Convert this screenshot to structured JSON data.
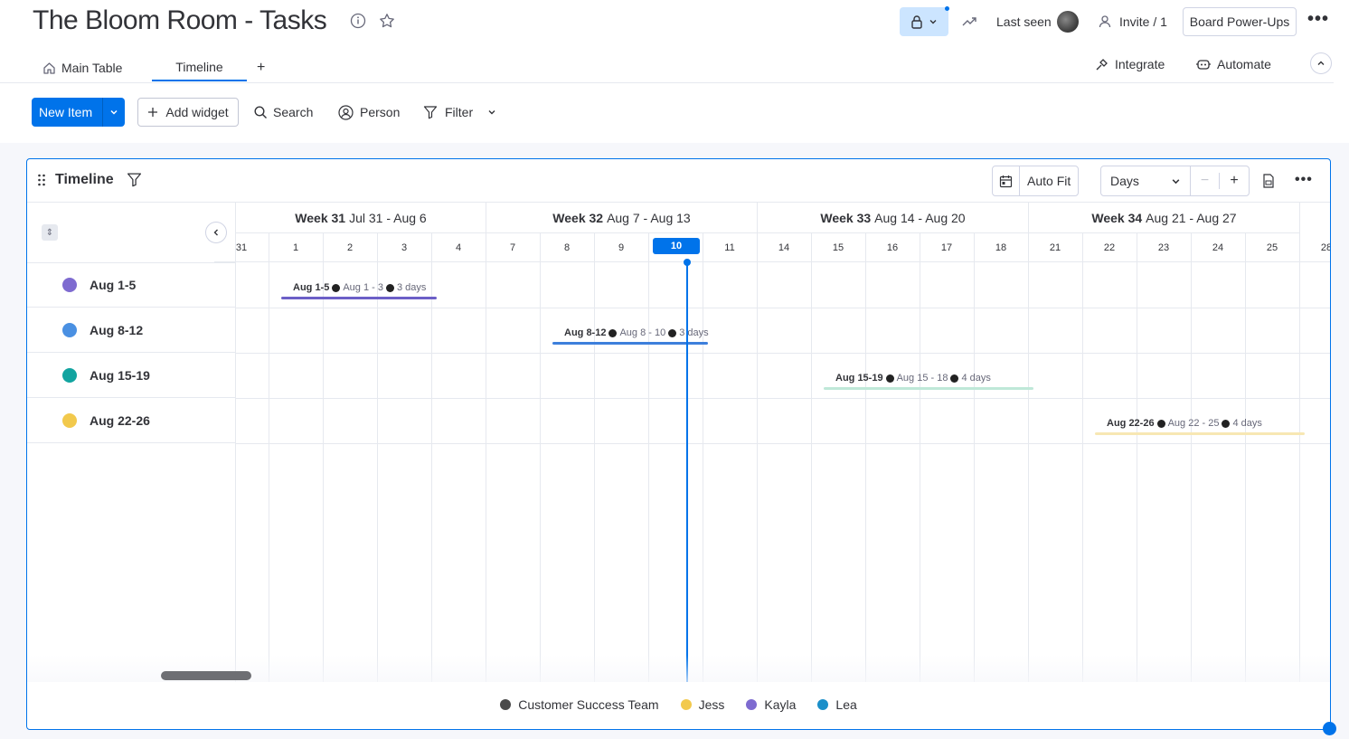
{
  "header": {
    "board_title": "The Bloom Room - Tasks",
    "last_seen_label": "Last seen",
    "invite_label": "Invite / 1",
    "power_ups_label": "Board Power-Ups"
  },
  "tabs": {
    "main_table": "Main Table",
    "timeline": "Timeline",
    "add": "+",
    "integrate": "Integrate",
    "automate": "Automate"
  },
  "toolbar": {
    "new_item": "New Item",
    "add_widget": "Add widget",
    "search": "Search",
    "person": "Person",
    "filter": "Filter"
  },
  "timeline": {
    "title": "Timeline",
    "auto_fit": "Auto Fit",
    "scale": "Days",
    "weeks": [
      {
        "label": "Week 31",
        "range": "Jul 31 - Aug 6"
      },
      {
        "label": "Week 32",
        "range": "Aug 7 - Aug 13"
      },
      {
        "label": "Week 33",
        "range": "Aug 14 - Aug 20"
      },
      {
        "label": "Week 34",
        "range": "Aug 21 - Aug 27"
      }
    ],
    "days": [
      "31",
      "1",
      "2",
      "3",
      "4",
      "7",
      "8",
      "9",
      "10",
      "11",
      "14",
      "15",
      "16",
      "17",
      "18",
      "21",
      "22",
      "23",
      "24",
      "25",
      "28"
    ],
    "today": "10",
    "rows": [
      {
        "name": "Aug 1-5",
        "color": "#7e6bd0",
        "bar_name": "Aug 1-5",
        "dates": "Aug 1 - 3",
        "duration": "3 days",
        "bar_color": "#6c5fc7"
      },
      {
        "name": "Aug 8-12",
        "color": "#4a90e2",
        "bar_name": "Aug 8-12",
        "dates": "Aug 8 - 10",
        "duration": "3 days",
        "bar_color": "#3d7fdc"
      },
      {
        "name": "Aug 15-19",
        "color": "#12a4a0",
        "bar_name": "Aug 15-19",
        "dates": "Aug 15 - 18",
        "duration": "4 days",
        "bar_color": "#bfe8d8"
      },
      {
        "name": "Aug 22-26",
        "color": "#f2c94c",
        "bar_name": "Aug 22-26",
        "dates": "Aug 22 - 25",
        "duration": "4 days",
        "bar_color": "#f7e7b3"
      }
    ],
    "legend": [
      {
        "name": "Customer Success Team",
        "color": "#4b4b4b"
      },
      {
        "name": "Jess",
        "color": "#f2c94c"
      },
      {
        "name": "Kayla",
        "color": "#7e6bd0"
      },
      {
        "name": "Lea",
        "color": "#1b8fc9"
      }
    ]
  }
}
